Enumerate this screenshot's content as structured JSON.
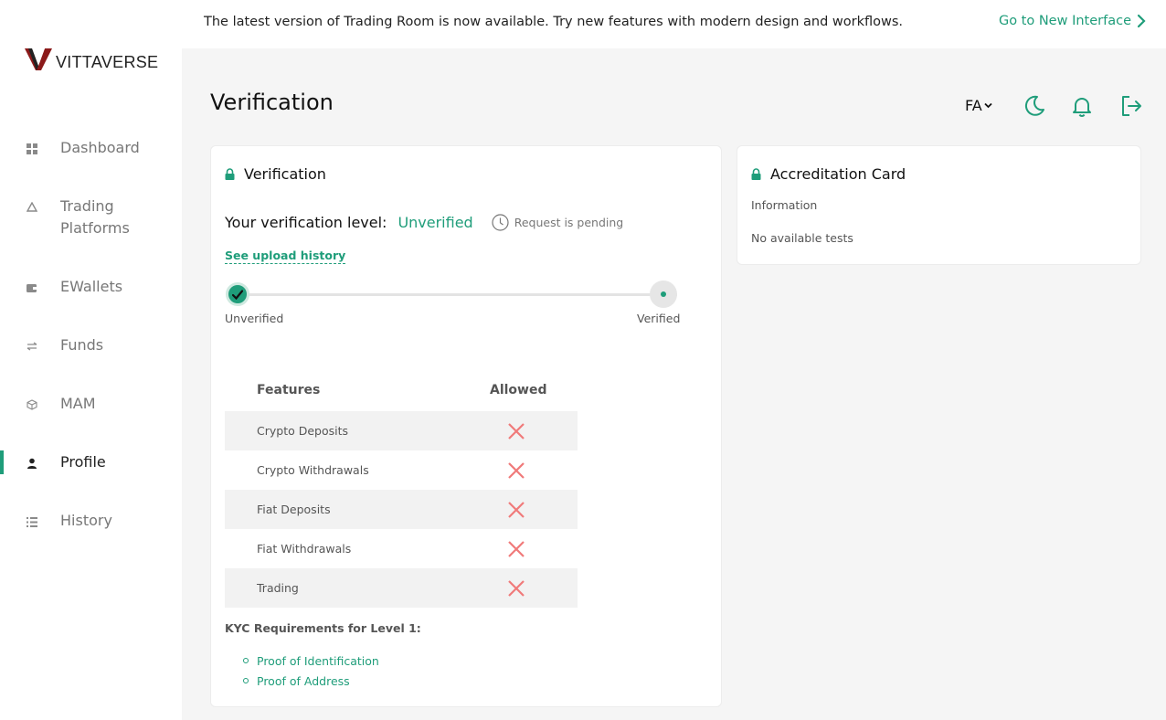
{
  "brand": {
    "name": "VITTAVERSE",
    "accent": "#1f9d7a",
    "logo_color": "#8b1a1a"
  },
  "banner": {
    "text": "The latest version of Trading Room is now available. Try new features with modern design and workflows.",
    "link_label": "Go to New Interface"
  },
  "sidebar": {
    "items": [
      {
        "label": "Dashboard",
        "icon": "grid-icon"
      },
      {
        "label": "Trading Platforms",
        "icon": "triangle-icon"
      },
      {
        "label": "EWallets",
        "icon": "wallet-icon"
      },
      {
        "label": "Funds",
        "icon": "transfer-icon"
      },
      {
        "label": "MAM",
        "icon": "cube-icon"
      },
      {
        "label": "Profile",
        "icon": "user-icon",
        "active": true
      },
      {
        "label": "History",
        "icon": "list-icon"
      }
    ]
  },
  "header": {
    "title": "Verification",
    "language": "FA",
    "icons": [
      "moon-icon",
      "bell-icon",
      "logout-icon"
    ]
  },
  "verification": {
    "card_title": "Verification",
    "level_label": "Your verification level:",
    "level_value": "Unverified",
    "pending_text": "Request is pending",
    "upload_history": "See upload history",
    "steps": {
      "start": "Unverified",
      "end": "Verified"
    },
    "features_header": "Features",
    "allowed_header": "Allowed",
    "features": [
      {
        "name": "Crypto Deposits",
        "allowed": false
      },
      {
        "name": "Crypto Withdrawals",
        "allowed": false
      },
      {
        "name": "Fiat Deposits",
        "allowed": false
      },
      {
        "name": "Fiat Withdrawals",
        "allowed": false
      },
      {
        "name": "Trading",
        "allowed": false
      }
    ],
    "kyc_title": "KYC Requirements for Level 1:",
    "kyc_items": [
      "Proof of Identification",
      "Proof of Address"
    ]
  },
  "accreditation": {
    "card_title": "Accreditation Card",
    "info_label": "Information",
    "empty_text": "No available tests"
  }
}
